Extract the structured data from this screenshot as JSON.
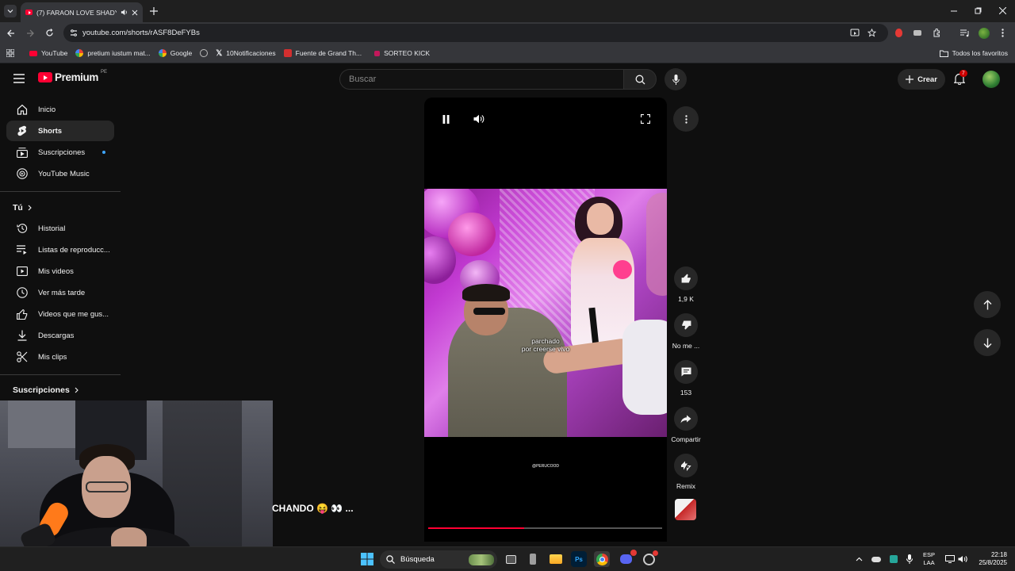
{
  "browser": {
    "tab_title": "(7) FARAON LOVE SHADY P",
    "url": "youtube.com/shorts/rASF8DeFYBs",
    "bookmarks": [
      "YouTube",
      "pretium iustum mat...",
      "Google",
      "10Notificaciones",
      "Fuente de Grand Th...",
      "SORTEO KICK"
    ],
    "all_bookmarks": "Todos los favoritos"
  },
  "youtube": {
    "logo_text": "Premium",
    "region": "PE",
    "search_placeholder": "Buscar",
    "create_label": "Crear",
    "notifications": "7",
    "sidebar": {
      "main": [
        {
          "label": "Inicio",
          "icon": "home-icon"
        },
        {
          "label": "Shorts",
          "icon": "shorts-icon",
          "active": true
        },
        {
          "label": "Suscripciones",
          "icon": "subscriptions-icon"
        },
        {
          "label": "YouTube Music",
          "icon": "music-icon"
        }
      ],
      "you_heading": "Tú",
      "you": [
        {
          "label": "Historial",
          "icon": "history-icon"
        },
        {
          "label": "Listas de reproducc...",
          "icon": "playlist-icon"
        },
        {
          "label": "Mis videos",
          "icon": "my-videos-icon"
        },
        {
          "label": "Ver más tarde",
          "icon": "clock-icon"
        },
        {
          "label": "Videos que me gus...",
          "icon": "like-icon"
        },
        {
          "label": "Descargas",
          "icon": "download-icon"
        },
        {
          "label": "Mis clips",
          "icon": "scissors-icon"
        }
      ],
      "subs_heading": "Suscripciones"
    },
    "player": {
      "caption_line1": "parchado",
      "caption_line2": "por creerse vivo",
      "watermark": "@PERUCOOD",
      "progress": 0.41
    },
    "actions": {
      "likes": "1,9 K",
      "dislike": "No me ...",
      "comments": "153",
      "share": "Compartir",
      "remix": "Remix"
    },
    "overlay_title": "CHANDO 😝 👀 ..."
  },
  "taskbar": {
    "search": "Búsqueda",
    "lang1": "ESP",
    "lang2": "LAA",
    "time": "22:18",
    "date": "25/8/2025"
  },
  "colors": {
    "accent": "#ff0033",
    "background": "#0f0f0f"
  }
}
